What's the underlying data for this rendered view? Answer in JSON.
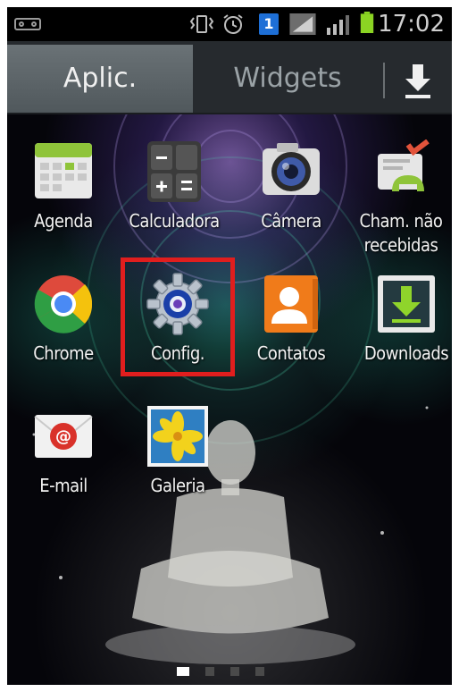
{
  "status_bar": {
    "time": "17:02",
    "icons": [
      "voicemail-icon",
      "vibrate-icon",
      "alarm-icon",
      "notification-badge-icon",
      "no-signal-icon",
      "signal-icon",
      "battery-icon"
    ],
    "badge_count": "1"
  },
  "tabs": {
    "apps_label": "Aplic.",
    "widgets_label": "Widgets",
    "active": "apps"
  },
  "apps": [
    {
      "label": "Agenda",
      "icon": "calendar-icon"
    },
    {
      "label": "Calculadora",
      "icon": "calculator-icon"
    },
    {
      "label": "Câmera",
      "icon": "camera-icon"
    },
    {
      "label": "Cham. não recebidas",
      "icon": "missed-calls-icon"
    },
    {
      "label": "Chrome",
      "icon": "chrome-icon"
    },
    {
      "label": "Config.",
      "icon": "settings-gear-icon"
    },
    {
      "label": "Contatos",
      "icon": "contacts-icon"
    },
    {
      "label": "Downloads",
      "icon": "downloads-icon"
    },
    {
      "label": "E-mail",
      "icon": "email-icon"
    },
    {
      "label": "Galeria",
      "icon": "gallery-icon"
    }
  ],
  "highlighted_app": "Config.",
  "highlight_color": "#e01e1e",
  "page_indicator": {
    "pages": 4,
    "current": 1
  }
}
